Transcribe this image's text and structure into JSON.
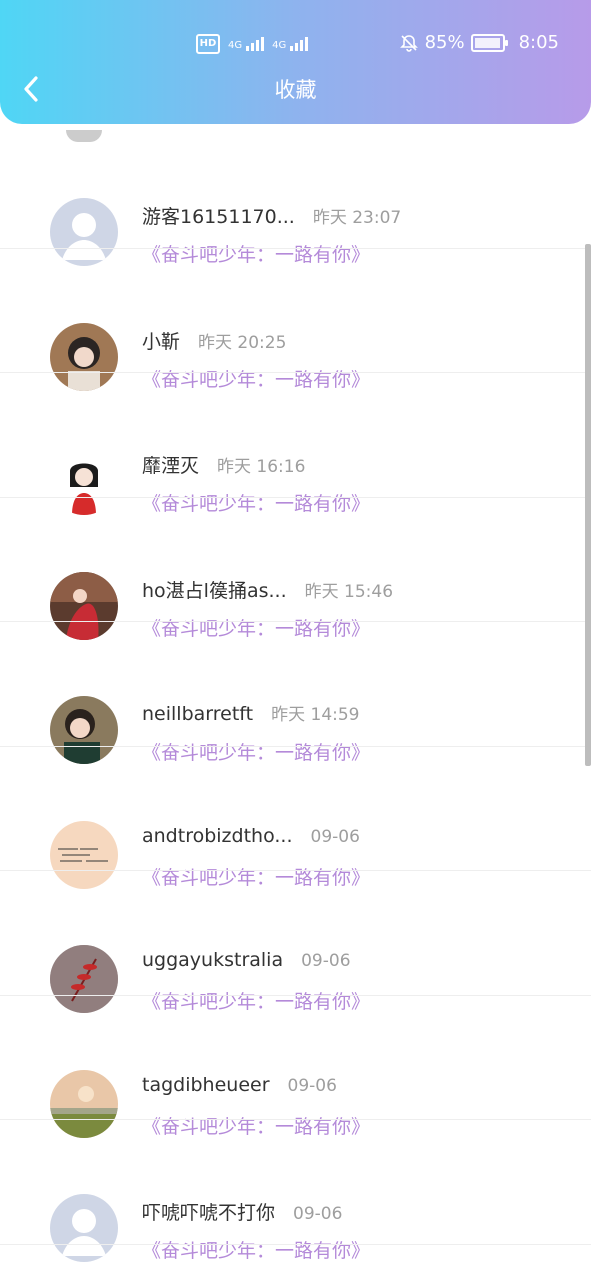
{
  "statusbar": {
    "hd": "HD",
    "net1": "4G",
    "net2": "4G",
    "battery": "85%",
    "battery_level": 0.85,
    "time": "8:05"
  },
  "header": {
    "title": "收藏"
  },
  "items": [
    {
      "name": "游客16151170...",
      "time": "昨天 23:07",
      "work": "《奋斗吧少年：一路有你》",
      "avatar": "default-avatar"
    },
    {
      "name": "小靳",
      "time": "昨天 20:25",
      "work": "《奋斗吧少年：一路有你》",
      "avatar": "girl-photo-avatar"
    },
    {
      "name": "靡湮灭",
      "time": "昨天 16:16",
      "work": "《奋斗吧少年：一路有你》",
      "avatar": "cartoon-girl-avatar"
    },
    {
      "name": "ho湛占l篌捅as...",
      "time": "昨天 15:46",
      "work": "《奋斗吧少年：一路有你》",
      "avatar": "red-dress-avatar"
    },
    {
      "name": "neillbarretft",
      "time": "昨天 14:59",
      "work": "《奋斗吧少年：一路有你》",
      "avatar": "smiling-girl-avatar"
    },
    {
      "name": "andtrobizdtho...",
      "time": "09-06",
      "work": "《奋斗吧少年：一路有你》",
      "avatar": "handwriting-avatar"
    },
    {
      "name": "uggayukstralia",
      "time": "09-06",
      "work": "《奋斗吧少年：一路有你》",
      "avatar": "red-leaf-avatar"
    },
    {
      "name": "tagdibheueer",
      "time": "09-06",
      "work": "《奋斗吧少年：一路有你》",
      "avatar": "sunset-field-avatar"
    },
    {
      "name": "吓唬吓唬不打你",
      "time": "09-06",
      "work": "《奋斗吧少年：一路有你》",
      "avatar": "default-avatar"
    }
  ],
  "colors": {
    "accent": "#b48ad9",
    "header_start": "#4fd6f5",
    "header_end": "#b79be9"
  }
}
